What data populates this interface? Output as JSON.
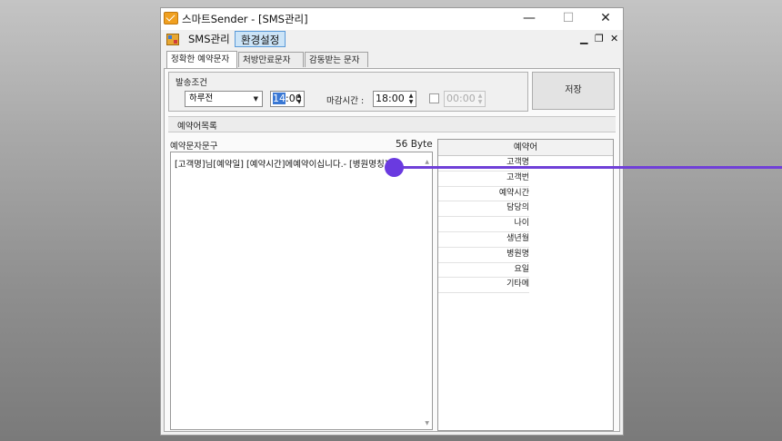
{
  "window": {
    "title": "스마트Sender - [SMS관리]",
    "min_symbol": "—",
    "max_symbol": "☐",
    "close_symbol": "✕"
  },
  "menu": {
    "items": [
      "SMS관리",
      "환경설정"
    ],
    "mdi_min": "▁",
    "mdi_max": "❐",
    "mdi_close": "✕"
  },
  "tabs": [
    {
      "label": "정확한 예약문자",
      "active": true
    },
    {
      "label": "처방만료문자",
      "active": false
    },
    {
      "label": "감동받는 문자",
      "active": false
    }
  ],
  "send_condition": {
    "label": "발송조건",
    "day_select": "하루전",
    "start_time_hour": "14",
    "start_time_rest": ":00",
    "deadline_label": "마감시간 :",
    "deadline_time": "18:00",
    "checkbox_checked": false,
    "disabled_time": "00:00"
  },
  "save_button": "저장",
  "reservation_list_label": "예약어목록",
  "message": {
    "label": "예약문자문구",
    "byte_count": "56 Byte",
    "text": "[고객명]님[예약일] [예약시간]에예약이십니다.- [병원명칭]"
  },
  "reserved_words": {
    "header": "예약어",
    "items": [
      "고객명",
      "고객번",
      "예약시간",
      "담당의",
      "나이",
      "생년월",
      "병원명",
      "요일",
      "기타메"
    ]
  },
  "colors": {
    "accent": "#3a78d4",
    "annotation": "#6a3ae0"
  }
}
